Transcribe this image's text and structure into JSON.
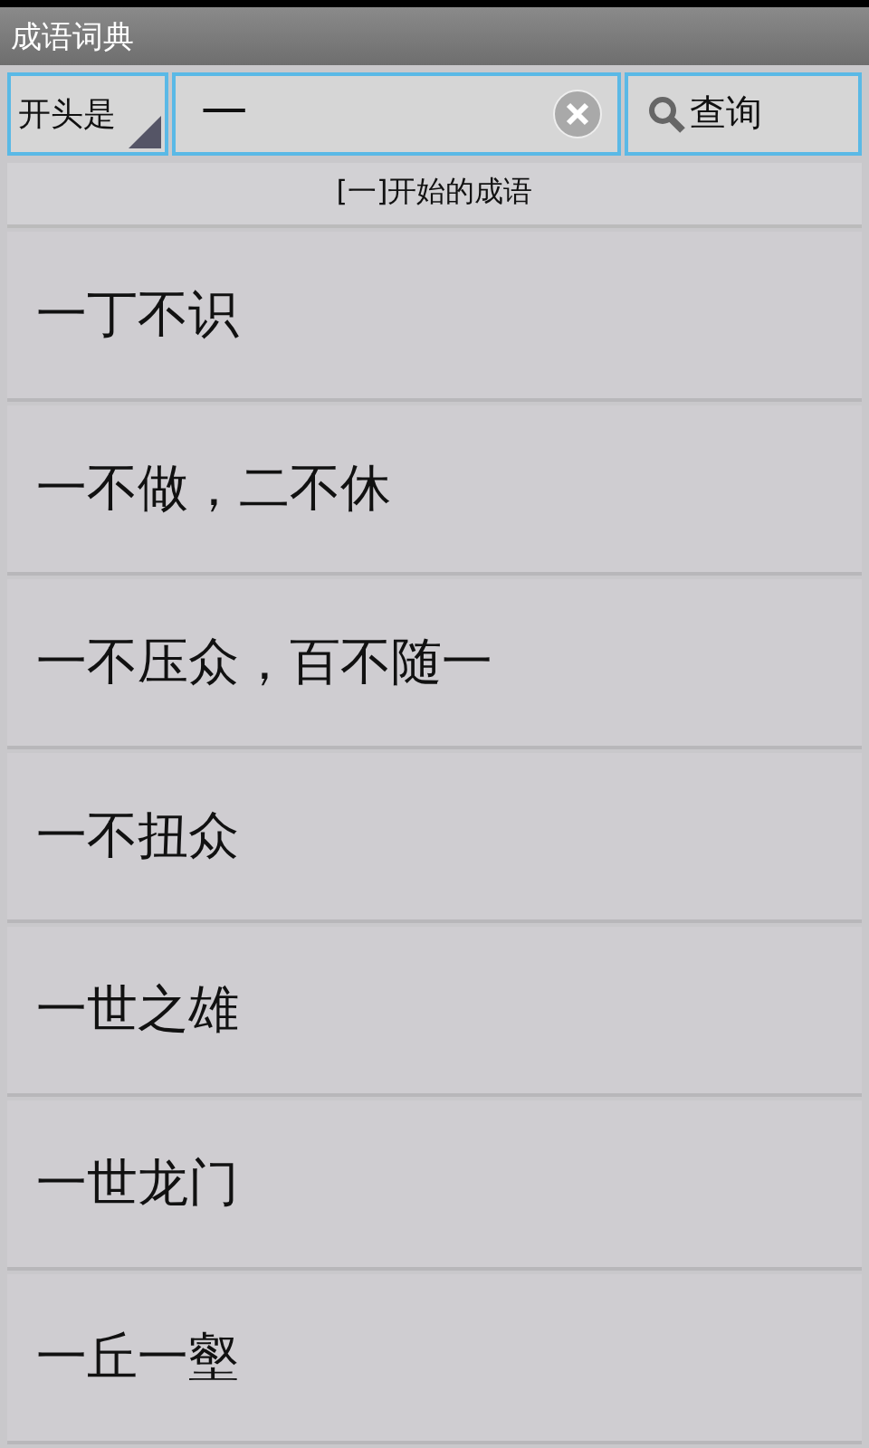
{
  "window": {
    "title": "成语词典"
  },
  "search": {
    "mode": "开头是",
    "value": "一",
    "button": "查询"
  },
  "results_header": "[一]开始的成语",
  "results": [
    "一丁不识",
    "一不做，二不休",
    "一不压众，百不随一",
    "一不扭众",
    "一世之雄",
    "一世龙门",
    "一丘一壑"
  ]
}
